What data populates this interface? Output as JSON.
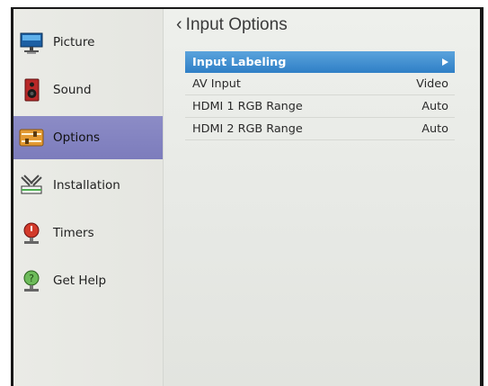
{
  "sidebar": {
    "items": [
      {
        "label": "Picture",
        "icon": "monitor-icon"
      },
      {
        "label": "Sound",
        "icon": "speaker-icon"
      },
      {
        "label": "Options",
        "icon": "sliders-icon",
        "selected": true
      },
      {
        "label": "Installation",
        "icon": "tools-icon"
      },
      {
        "label": "Timers",
        "icon": "timer-icon"
      },
      {
        "label": "Get Help",
        "icon": "help-icon"
      }
    ]
  },
  "header": {
    "back_label": "Input Options",
    "back_glyph": "‹"
  },
  "menu": {
    "rows": [
      {
        "label": "Input Labeling",
        "value": ""
      },
      {
        "label": "AV Input",
        "value": "Video"
      },
      {
        "label": "HDMI 1 RGB Range",
        "value": "Auto"
      },
      {
        "label": "HDMI 2 RGB Range",
        "value": "Auto"
      }
    ]
  },
  "colors": {
    "highlight": "#2f7fc6",
    "selected_sidebar": "#7f7fbf",
    "bezel": "#181818"
  }
}
